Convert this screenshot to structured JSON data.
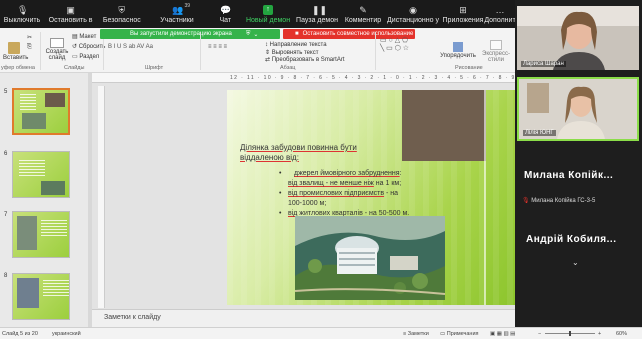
{
  "zoom_toolbar": {
    "mute": "Выключить",
    "stop_video": "Остановить в",
    "security": "Безопаснос",
    "participants": "Участники",
    "participants_count": "39",
    "chat": "Чат",
    "new_share": "Новый демон",
    "pause_share": "Пауза демон",
    "annotate": "Комментир",
    "remote": "Дистанционно у",
    "apps": "Приложения",
    "more": "Дополнит"
  },
  "share_banner": {
    "status": "Вы запустили демонстрацию экрана",
    "stop": "Остановить совместное использование"
  },
  "ribbon": {
    "insert": "Вставить",
    "create_slide": "Создать\nслайд",
    "layout": "Макет",
    "reset": "Сбросить",
    "section": "Раздел",
    "groups": [
      "уфер обмена",
      "Слайды",
      "Шрифт",
      "Абзац",
      "Рисование"
    ],
    "text_direction": "Направление текста",
    "align_text": "Выровнять текст",
    "smartart": "Преобразовать в SmartArt",
    "arrange": "Упорядочить",
    "quick_styles": "Экспресс-\nстили"
  },
  "thumbnails": [
    {
      "num": "5",
      "selected": true
    },
    {
      "num": "6",
      "selected": false
    },
    {
      "num": "7",
      "selected": false
    },
    {
      "num": "8",
      "selected": false
    }
  ],
  "ruler_marks": "12 · 11 · 10 · 9 · 8 · 7 · 6 · 5 · 4 · 3 · 2 · 1 · 0 · 1 · 2 · 3 · 4 · 5 · 6 · 7 · 8 · 9 · 10 · 11 · 12",
  "slide": {
    "title_1": "Ділянка забудови повинна бути",
    "title_2": "віддаленою від:",
    "items": [
      {
        "text_u": "джерел ймовірного забруднення",
        "text": ":"
      },
      {
        "text_u": "від звалищ - не менше ніж",
        "text": " на 1 км;"
      },
      {
        "text_u": "від промислових підприємств",
        "text": " - на"
      },
      {
        "text_u": "",
        "text": "100-1000 м;"
      },
      {
        "text_u": "від житлових кварталів",
        "text": " - на 50-500 м."
      }
    ]
  },
  "notes_placeholder": "Заметки к слайду",
  "status": {
    "slide_of": "Слайд 5 из 20",
    "language": "украинский",
    "notes": "Заметки",
    "comments": "Примечания",
    "zoom": "60%"
  },
  "participants": [
    {
      "name": "Лариса Шаран"
    },
    {
      "name": "Лілія ЮНГ"
    }
  ],
  "participants_text": {
    "big_1": "Милана  Копійк...",
    "small_1": "Милана Копійка ГС-3-5",
    "big_2": "Андрій  Кобиля..."
  },
  "colors": {
    "zoom_green": "#35b34a",
    "zoom_red": "#e4322b",
    "slide_green": "#8cc52c",
    "speaking_border": "#8bdd49"
  }
}
